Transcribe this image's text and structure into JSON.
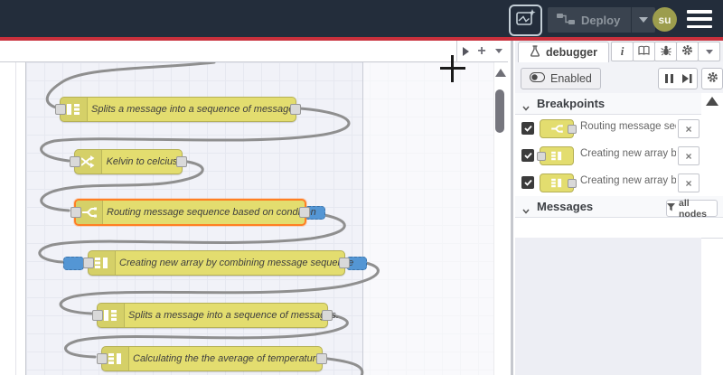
{
  "header": {
    "deploy": {
      "label": "Deploy"
    },
    "avatar": {
      "text": "su"
    }
  },
  "workspace": {
    "nodes": [
      {
        "label": "Splits a message into a sequence of messages.",
        "type": "split"
      },
      {
        "label": "Kelvin to celcius",
        "type": "change"
      },
      {
        "label": "Routing message sequence based on condition",
        "type": "switch",
        "selected": true,
        "breakpoints": [
          "output"
        ]
      },
      {
        "label": "Creating new array by combining message sequence",
        "type": "join",
        "breakpoints": [
          "input",
          "output"
        ]
      },
      {
        "label": "Splits a message into a sequence of messages.",
        "type": "split"
      },
      {
        "label": "Calculating the the average of temperature",
        "type": "join"
      }
    ]
  },
  "sidebar": {
    "tab": {
      "label": "debugger"
    },
    "toolbar": {
      "enabled_label": "Enabled"
    },
    "breakpoints": {
      "title": "Breakpoints",
      "items": [
        {
          "checked": true,
          "node_type": "switch",
          "port_side": "right",
          "label": "Routing message sequence based on condition"
        },
        {
          "checked": true,
          "node_type": "join",
          "port_side": "left",
          "label": "Creating new array by combining message sequence"
        },
        {
          "checked": true,
          "node_type": "join",
          "port_side": "right",
          "label": "Creating new array by combining message sequence"
        }
      ]
    },
    "messages": {
      "title": "Messages",
      "filter_label": "all nodes"
    }
  },
  "icons": {
    "header": [
      "export-image-icon",
      "deploy-node-icon",
      "chevron-down-icon",
      "hamburger-menu-icon"
    ],
    "workspace_toolbar": [
      "scroll-tabs-right-icon",
      "add-tab-icon",
      "tab-list-chevron-icon"
    ],
    "sidebar": [
      "flask-icon",
      "info-icon",
      "book-icon",
      "bug-icon",
      "gear-icon",
      "chevron-down-icon",
      "toggle-icon",
      "pause-icon",
      "step-icon",
      "funnel-icon",
      "checkbox-check-icon",
      "close-icon"
    ]
  },
  "colors": {
    "header_bg": "#232d3b",
    "alert_bar": "#c9303c",
    "node_fill": "#e3dd6f",
    "node_border": "#b5b055",
    "selected_border": "#ff7f23",
    "breakpoint_marker": "#5496d4",
    "wire": "#8f8f8f",
    "avatar_bg": "#9c9d4d"
  }
}
